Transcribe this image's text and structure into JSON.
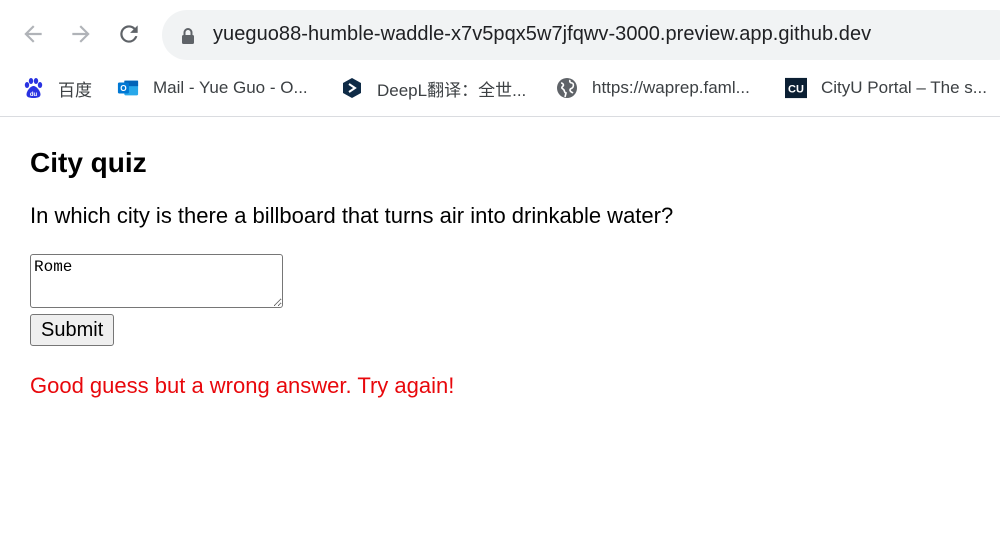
{
  "browser": {
    "url": "yueguo88-humble-waddle-x7v5pqx5w7jfqwv-3000.preview.app.github.dev",
    "bookmarks": [
      {
        "label": "百度",
        "icon": "baidu-icon"
      },
      {
        "label": "Mail - Yue Guo - O...",
        "icon": "outlook-icon"
      },
      {
        "label": "DeepL翻译：全世...",
        "icon": "deepl-icon"
      },
      {
        "label": "https://waprep.faml...",
        "icon": "globe-icon"
      },
      {
        "label": "CityU Portal – The s...",
        "icon": "cityu-icon"
      }
    ],
    "cityu_icon_text": "CU"
  },
  "page": {
    "title": "City quiz",
    "question": "In which city is there a billboard that turns air into drinkable water?",
    "answer_value": "Rome",
    "submit_label": "Submit",
    "feedback": "Good guess but a wrong answer. Try again!",
    "feedback_color": "#e8080c"
  }
}
